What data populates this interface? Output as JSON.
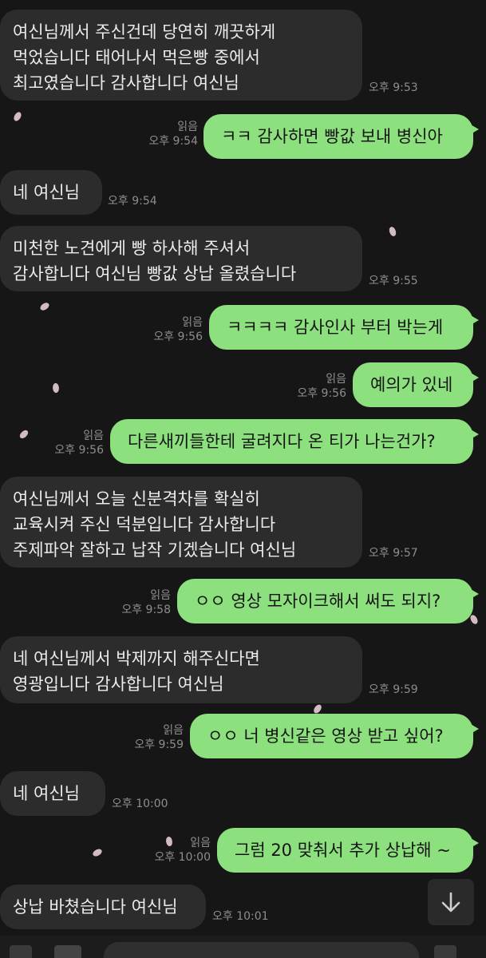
{
  "colors": {
    "background": "#161616",
    "incoming_bubble": "#2c2c2c",
    "outgoing_bubble": "#8de07e",
    "meta_text": "#8d8d8d"
  },
  "messages": [
    {
      "side": "in",
      "lines": [
        "여신님께서 주신건데 당연히 깨끗하게",
        "먹었습니다 태어나서 먹은빵 중에서",
        "최고였습니다 감사합니다 여신님"
      ],
      "time": "오후 9:53"
    },
    {
      "side": "out",
      "lines": [
        "ㅋㅋ 감사하면 빵값 보내 병신아"
      ],
      "read": "읽음",
      "time": "오후 9:54"
    },
    {
      "side": "in",
      "lines": [
        "네 여신님"
      ],
      "time": "오후 9:54"
    },
    {
      "side": "in",
      "lines": [
        "미천한 노견에게 빵 하사해 주셔서",
        "감사합니다 여신님 빵값 상납 올렸습니다"
      ],
      "time": "오후 9:55"
    },
    {
      "side": "out",
      "lines": [
        "ㅋㅋㅋㅋ 감사인사 부터 박는게"
      ],
      "read": "읽음",
      "time": "오후 9:56"
    },
    {
      "side": "out",
      "lines": [
        "예의가 있네"
      ],
      "read": "읽음",
      "time": "오후 9:56"
    },
    {
      "side": "out",
      "lines": [
        "다른새끼들한테 굴려지다 온 티가 나는건가?"
      ],
      "read": "읽음",
      "time": "오후 9:56"
    },
    {
      "side": "in",
      "lines": [
        "여신님께서 오늘 신분격차를 확실히",
        "교육시켜 주신 덕분입니다 감사합니다",
        "주제파악 잘하고 납작 기겠습니다 여신님"
      ],
      "time": "오후 9:57"
    },
    {
      "side": "out",
      "lines": [
        "ㅇㅇ 영상 모자이크해서 써도 되지?"
      ],
      "read": "읽음",
      "time": "오후 9:58"
    },
    {
      "side": "in",
      "lines": [
        "네 여신님께서 박제까지 해주신다면",
        "영광입니다 감사합니다 여신님"
      ],
      "time": "오후 9:59"
    },
    {
      "side": "out",
      "lines": [
        "ㅇㅇ 너 병신같은 영상 받고 싶어?"
      ],
      "read": "읽음",
      "time": "오후 9:59"
    },
    {
      "side": "in",
      "lines": [
        "네 여신님"
      ],
      "time": "오후 10:00"
    },
    {
      "side": "out",
      "lines": [
        "그럼 20 맞춰서 추가 상납해 ~"
      ],
      "read": "읽음",
      "time": "오후 10:00"
    },
    {
      "side": "in",
      "lines": [
        "상납 바쳤습니다 여신님"
      ],
      "time": "오후 10:01"
    }
  ],
  "scroll_button_icon": "arrow-down-icon"
}
